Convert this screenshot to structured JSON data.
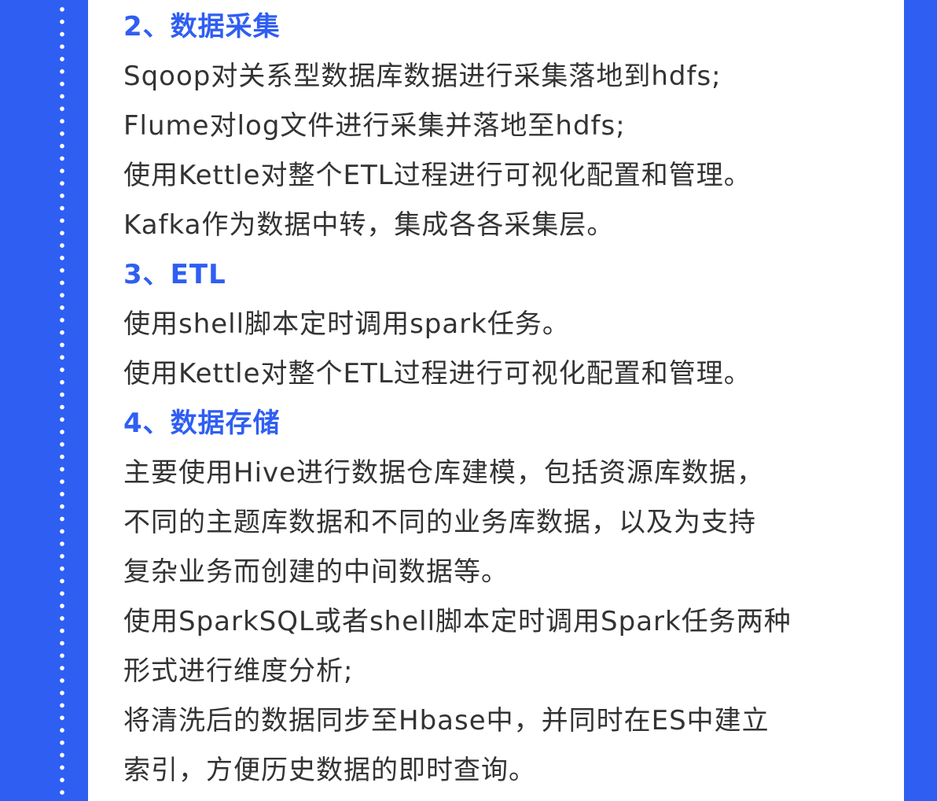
{
  "lines": [
    {
      "text": "2、数据采集",
      "kind": "heading"
    },
    {
      "text": "Sqoop对关系型数据库数据进行采集落地到hdfs;",
      "kind": "body"
    },
    {
      "text": "Flume对log文件进行采集并落地至hdfs;",
      "kind": "body"
    },
    {
      "text": "使用Kettle对整个ETL过程进行可视化配置和管理。",
      "kind": "body"
    },
    {
      "text": "Kafka作为数据中转，集成各各采集层。",
      "kind": "body"
    },
    {
      "text": "3、ETL",
      "kind": "heading"
    },
    {
      "text": "使用shell脚本定时调用spark任务。",
      "kind": "body"
    },
    {
      "text": "使用Kettle对整个ETL过程进行可视化配置和管理。",
      "kind": "body"
    },
    {
      "text": "4、数据存储",
      "kind": "heading"
    },
    {
      "text": "主要使用Hive进行数据仓库建模，包括资源库数据，",
      "kind": "body"
    },
    {
      "text": "不同的主题库数据和不同的业务库数据，以及为支持",
      "kind": "body"
    },
    {
      "text": "复杂业务而创建的中间数据等。",
      "kind": "body"
    },
    {
      "text": "使用SparkSQL或者shell脚本定时调用Spark任务两种",
      "kind": "body"
    },
    {
      "text": "形式进行维度分析;",
      "kind": "body"
    },
    {
      "text": "将清洗后的数据同步至Hbase中，并同时在ES中建立",
      "kind": "body"
    },
    {
      "text": "索引，方便历史数据的即时查询。",
      "kind": "body"
    }
  ],
  "colors": {
    "accent": "#2f5ef3",
    "body_text": "#333333",
    "background": "#ffffff"
  }
}
